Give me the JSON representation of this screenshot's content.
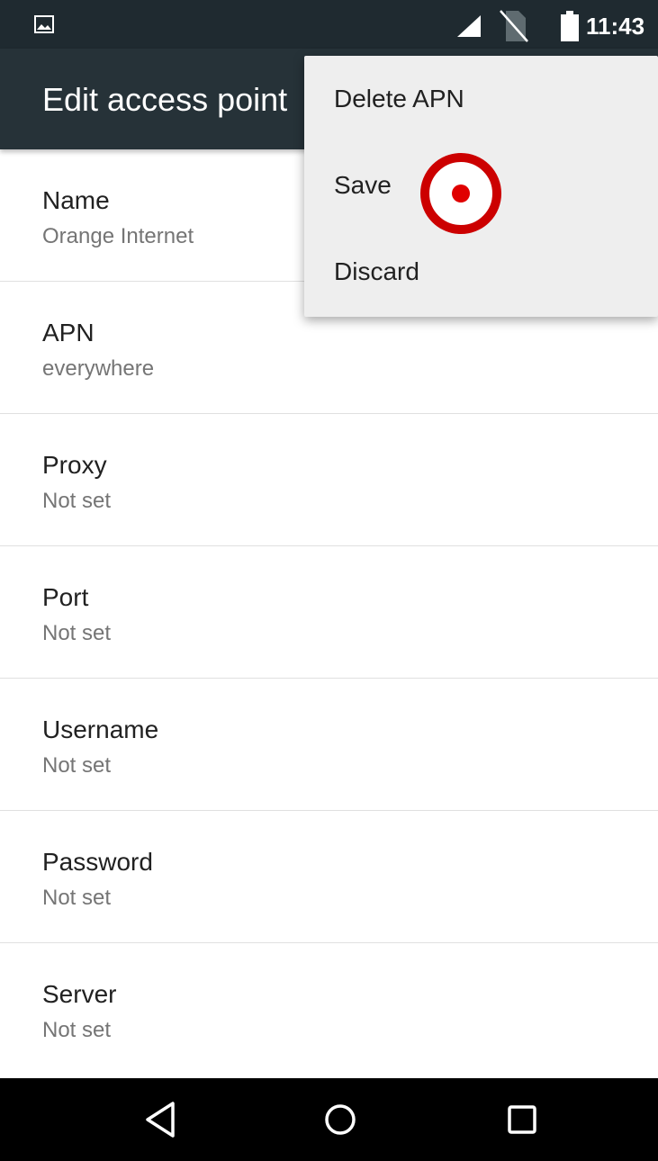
{
  "status_bar": {
    "time": "11:43",
    "icons": [
      "gallery-icon",
      "signal-icon",
      "no-sim-icon",
      "battery-icon"
    ]
  },
  "app_bar": {
    "title": "Edit access point"
  },
  "settings": [
    {
      "label": "Name",
      "value": "Orange Internet"
    },
    {
      "label": "APN",
      "value": "everywhere"
    },
    {
      "label": "Proxy",
      "value": "Not set"
    },
    {
      "label": "Port",
      "value": "Not set"
    },
    {
      "label": "Username",
      "value": "Not set"
    },
    {
      "label": "Password",
      "value": "Not set"
    },
    {
      "label": "Server",
      "value": "Not set"
    }
  ],
  "overflow_menu": {
    "items": [
      {
        "label": "Delete APN"
      },
      {
        "label": "Save"
      },
      {
        "label": "Discard"
      }
    ]
  },
  "nav_bar": {
    "icons": [
      "back-icon",
      "home-icon",
      "recent-apps-icon"
    ]
  },
  "colors": {
    "status_bar": "#1f2a30",
    "app_bar": "#263238",
    "menu_bg": "#eeeeee",
    "tap_marker": "#e00000"
  }
}
